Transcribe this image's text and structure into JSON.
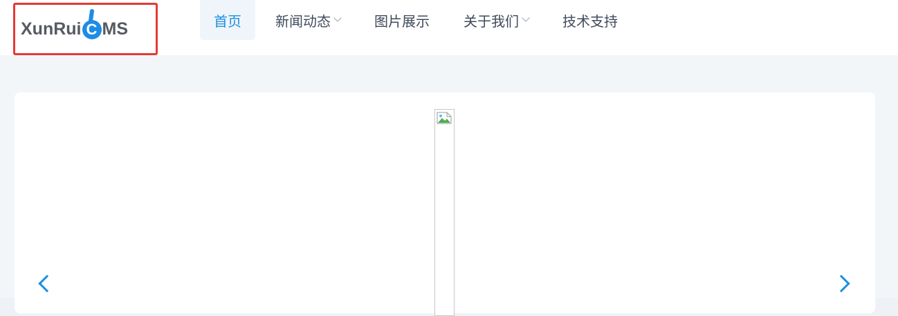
{
  "site": {
    "logo_text_a": "XunRui",
    "logo_letter": "C",
    "logo_text_b": "MS"
  },
  "nav": {
    "items": [
      {
        "label": "首页",
        "active": true,
        "has_dropdown": false
      },
      {
        "label": "新闻动态",
        "active": false,
        "has_dropdown": true
      },
      {
        "label": "图片展示",
        "active": false,
        "has_dropdown": false
      },
      {
        "label": "关于我们",
        "active": false,
        "has_dropdown": true
      },
      {
        "label": "技术支持",
        "active": false,
        "has_dropdown": false
      }
    ]
  },
  "colors": {
    "accent": "#1a8fe0",
    "logo_highlight": "#e53935",
    "nav_text": "#3f4a5a",
    "page_bg": "#eef2f7"
  },
  "banner": {
    "image_state": "broken-image",
    "prev_icon": "chevron-left-icon",
    "next_icon": "chevron-right-icon"
  }
}
